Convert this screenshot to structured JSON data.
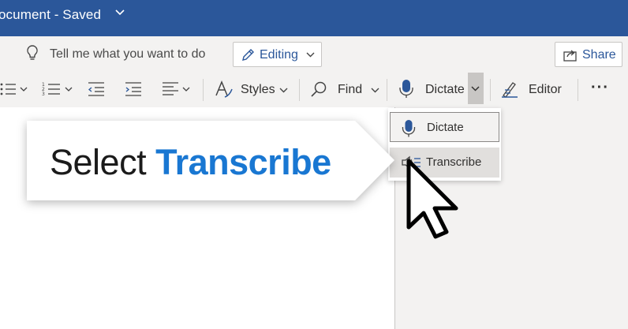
{
  "title_bar": {
    "document_title": "ocument - Saved",
    "background": "#2b579a"
  },
  "ribbon": {
    "tell_me": {
      "icon": "lightbulb-icon",
      "text": "Tell me what you want to do"
    },
    "editing": {
      "icon": "pencil-icon",
      "label": "Editing"
    },
    "share": {
      "icon": "share-icon",
      "label": "Share"
    },
    "tools": {
      "styles": "Styles",
      "find": "Find",
      "dictate": "Dictate",
      "editor": "Editor",
      "more": "···"
    }
  },
  "dictate_menu": {
    "items": [
      {
        "icon": "microphone-icon",
        "label": "Dictate"
      },
      {
        "icon": "transcribe-icon",
        "label": "Transcribe"
      }
    ]
  },
  "callout": {
    "prefix": "Select",
    "highlight": "Transcribe",
    "highlight_color": "#1977d2"
  },
  "accent_color": "#2b579a"
}
